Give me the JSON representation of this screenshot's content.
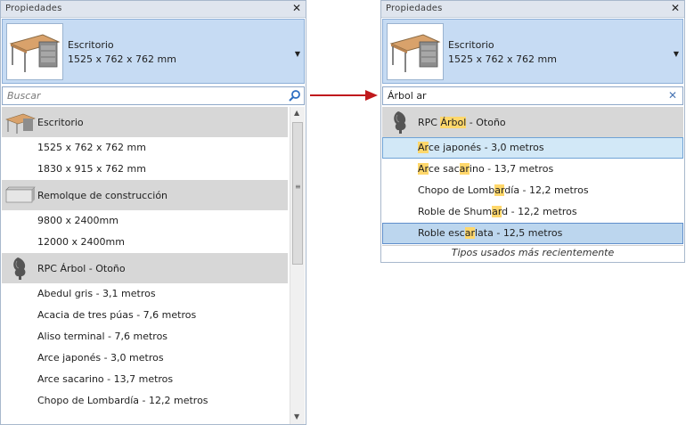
{
  "left": {
    "title": "Propiedades",
    "selector": {
      "name": "Escritorio",
      "dims": "1525 x 762 x 762 mm"
    },
    "search_placeholder": "Buscar",
    "groups": [
      {
        "label": "Escritorio",
        "items": [
          "1525 x 762 x 762 mm",
          "1830 x 915 x 762 mm"
        ]
      },
      {
        "label": "Remolque de construcción",
        "items": [
          "9800 x 2400mm",
          "12000 x 2400mm"
        ]
      },
      {
        "label": "RPC Árbol - Otoño",
        "items": [
          "Abedul gris - 3,1 metros",
          "Acacia de tres púas - 7,6 metros",
          "Aliso terminal - 7,6 metros",
          "Arce japonés - 3,0 metros",
          "Arce sacarino - 13,7 metros",
          "Chopo de Lombardía - 12,2 metros"
        ]
      }
    ]
  },
  "right": {
    "title": "Propiedades",
    "selector": {
      "name": "Escritorio",
      "dims": "1525 x 762 x 762 mm"
    },
    "search_value": "Árbol ar",
    "group": {
      "label_pre": "RPC ",
      "label_hl": "Árbol",
      "label_post": " - Otoño"
    },
    "items": [
      {
        "pre": "",
        "hl": "Ar",
        "post": "ce japonés - 3,0 metros"
      },
      {
        "pre": "",
        "hl": "Ar",
        "post": "ce sac"
      },
      {
        "pre": "Chopo de Lomb",
        "hl": "ar",
        "post": "día - 12,2 metros"
      },
      {
        "pre": "Roble de Shum",
        "hl": "ar",
        "post": "d - 12,2 metros"
      },
      {
        "pre": "Roble esc",
        "hl": "ar",
        "post": "lata - 12,5 metros"
      }
    ],
    "item2_extra": {
      "hl2": "ar",
      "post2": "ino - 13,7 metros"
    },
    "recent_label": "Tipos usados más recientemente"
  },
  "colors": {
    "highlight": "#ffd76b",
    "selection": "#d2e8f7",
    "accent_arrow": "#c0191c"
  }
}
